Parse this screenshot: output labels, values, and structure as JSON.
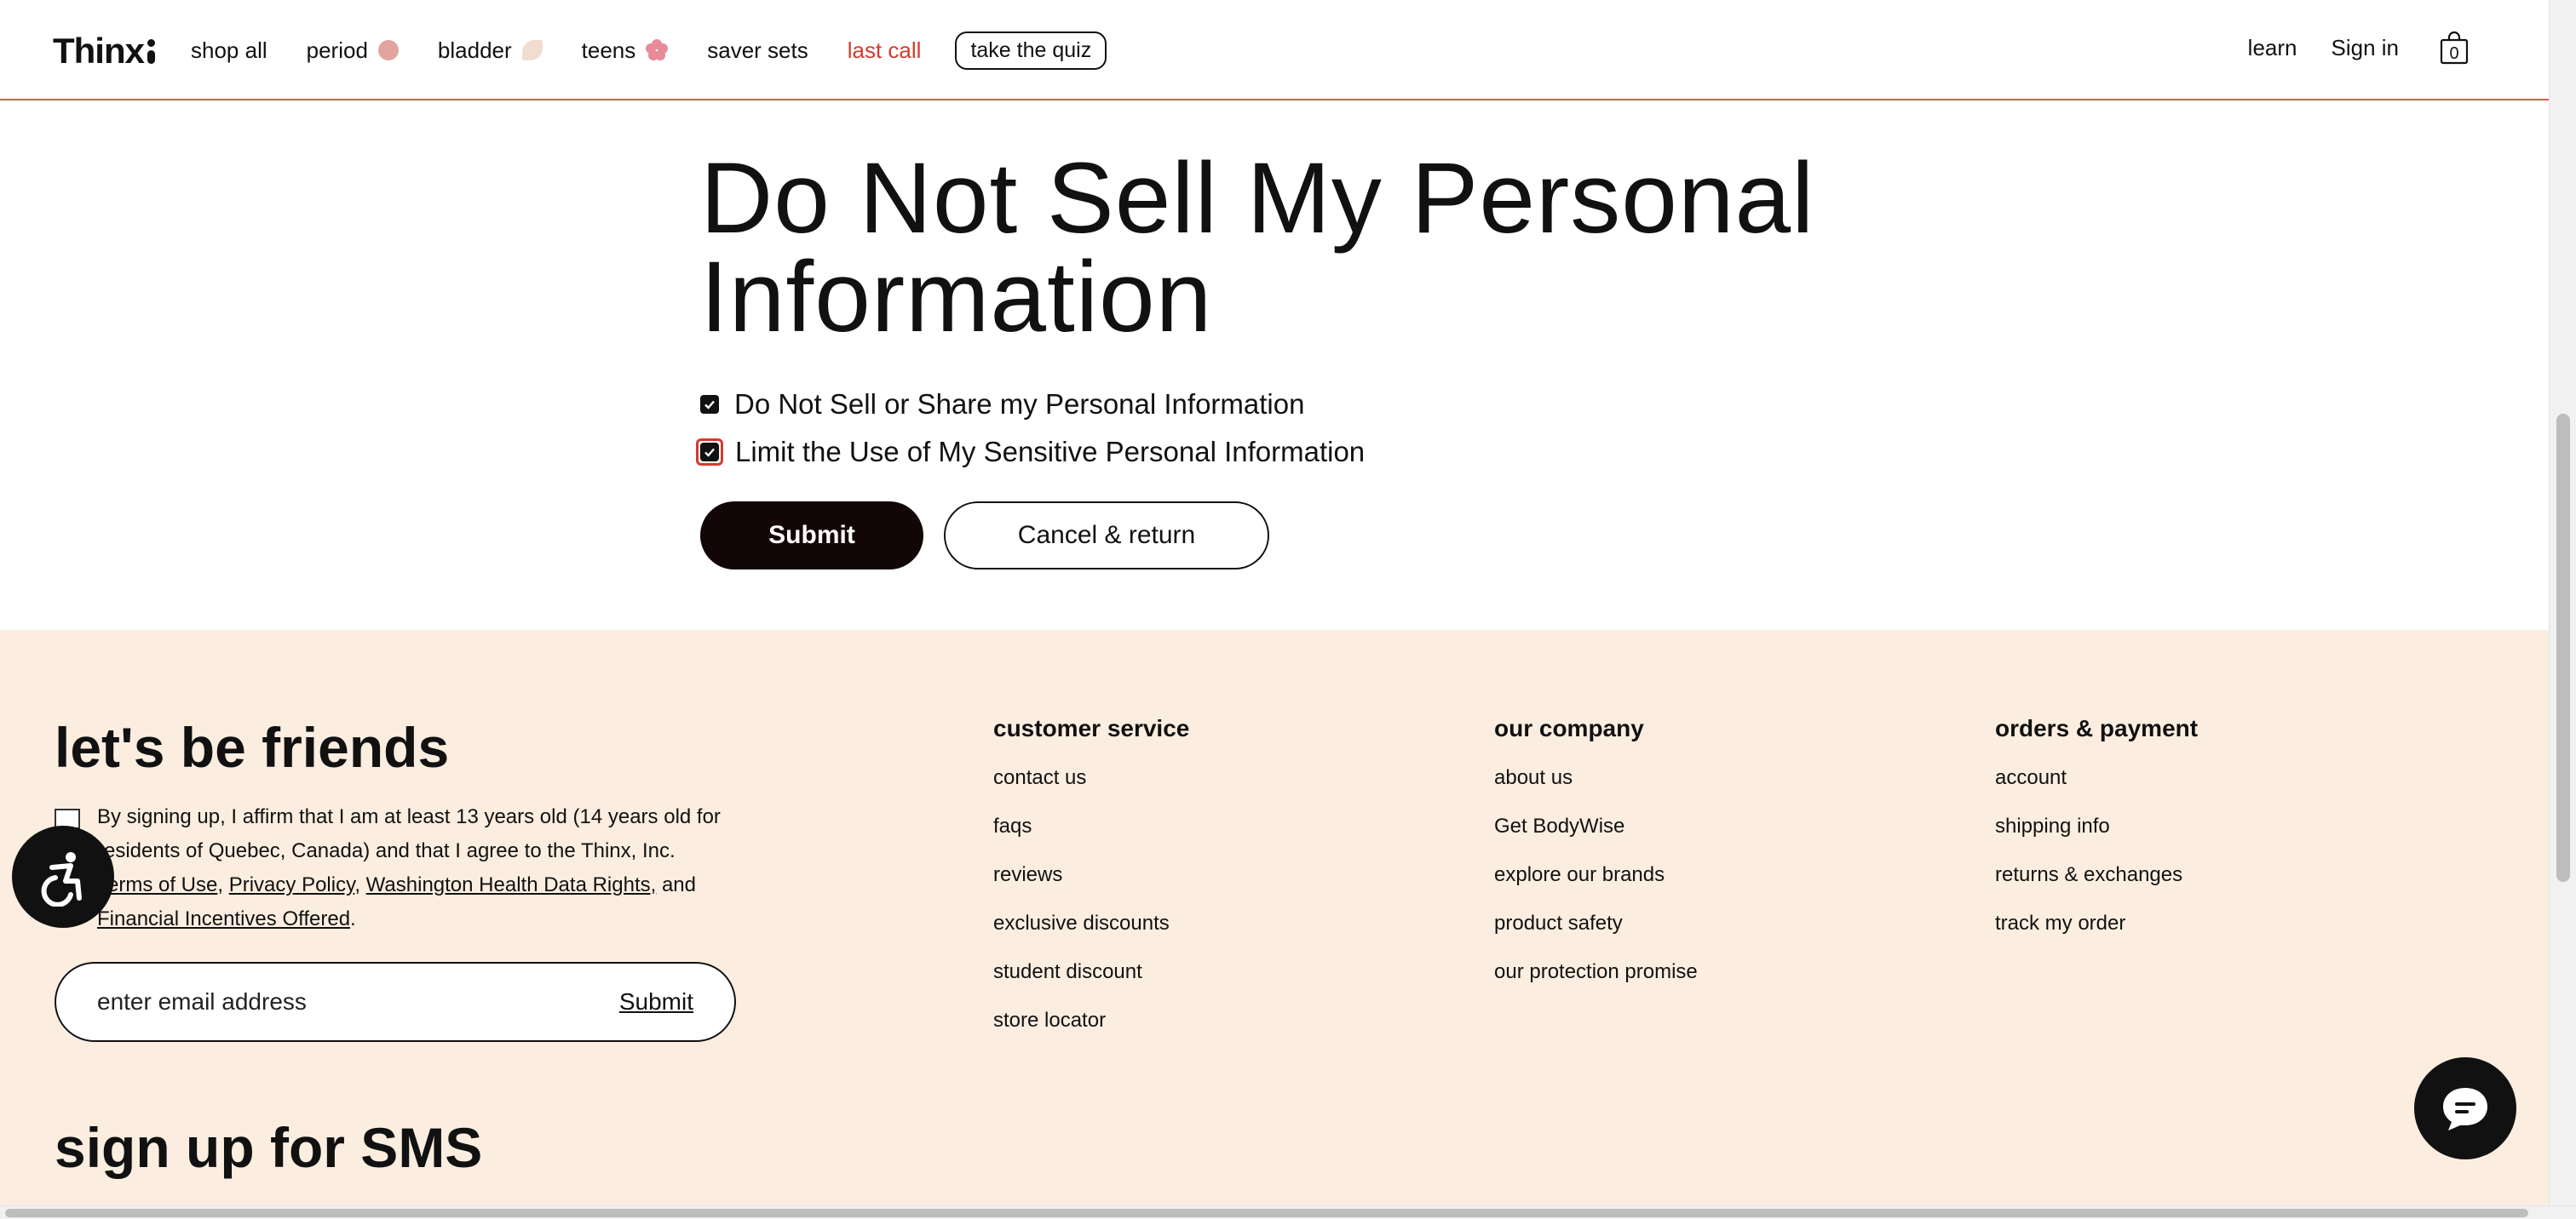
{
  "header": {
    "logo": "Thinx",
    "nav": [
      {
        "label": "shop all",
        "dot": null
      },
      {
        "label": "period",
        "dot": "#e3a4a0"
      },
      {
        "label": "bladder",
        "dot": "#f1dcd0"
      },
      {
        "label": "teens",
        "dot": "#e88a99"
      },
      {
        "label": "saver sets",
        "dot": null
      },
      {
        "label": "last call",
        "dot": null,
        "color": "#d63a2e"
      }
    ],
    "quiz_label": "take the quiz",
    "learn_label": "learn",
    "signin_label": "Sign in",
    "cart_count": "0"
  },
  "main": {
    "title": "Do Not Sell My Personal Information",
    "options": [
      {
        "label": "Do Not Sell or Share my Personal Information",
        "checked": true
      },
      {
        "label": "Limit the Use of My Sensitive Personal Information",
        "checked": true
      }
    ],
    "submit_label": "Submit",
    "cancel_label": "Cancel & return"
  },
  "footer": {
    "newsletter_title": "let's be friends",
    "consent_prefix": "By signing up, I affirm that I am at least 13 years old (14 years old for residents of Quebec, Canada) and that I agree to the Thinx, Inc. ",
    "terms_label": "Terms of Use",
    "privacy_label": "Privacy Policy",
    "health_label": "Washington Health Data Rights,",
    "and_text": " and ",
    "financial_label": "Financial Incentives Offered",
    "email_placeholder": "enter email address",
    "email_submit_label": "Submit",
    "sms_title": "sign up for SMS",
    "columns": [
      {
        "title": "customer service",
        "links": [
          "contact us",
          "faqs",
          "reviews",
          "exclusive discounts",
          "student discount",
          "store locator"
        ]
      },
      {
        "title": "our company",
        "links": [
          "about us",
          "Get BodyWise",
          "explore our brands",
          "product safety",
          "our protection promise"
        ]
      },
      {
        "title": "orders & payment",
        "links": [
          "account",
          "shipping info",
          "returns & exchanges",
          "track my order"
        ]
      }
    ]
  },
  "colors": {
    "accent_red": "#d63a2e",
    "footer_bg": "#fbeee0",
    "dark": "#120706"
  }
}
